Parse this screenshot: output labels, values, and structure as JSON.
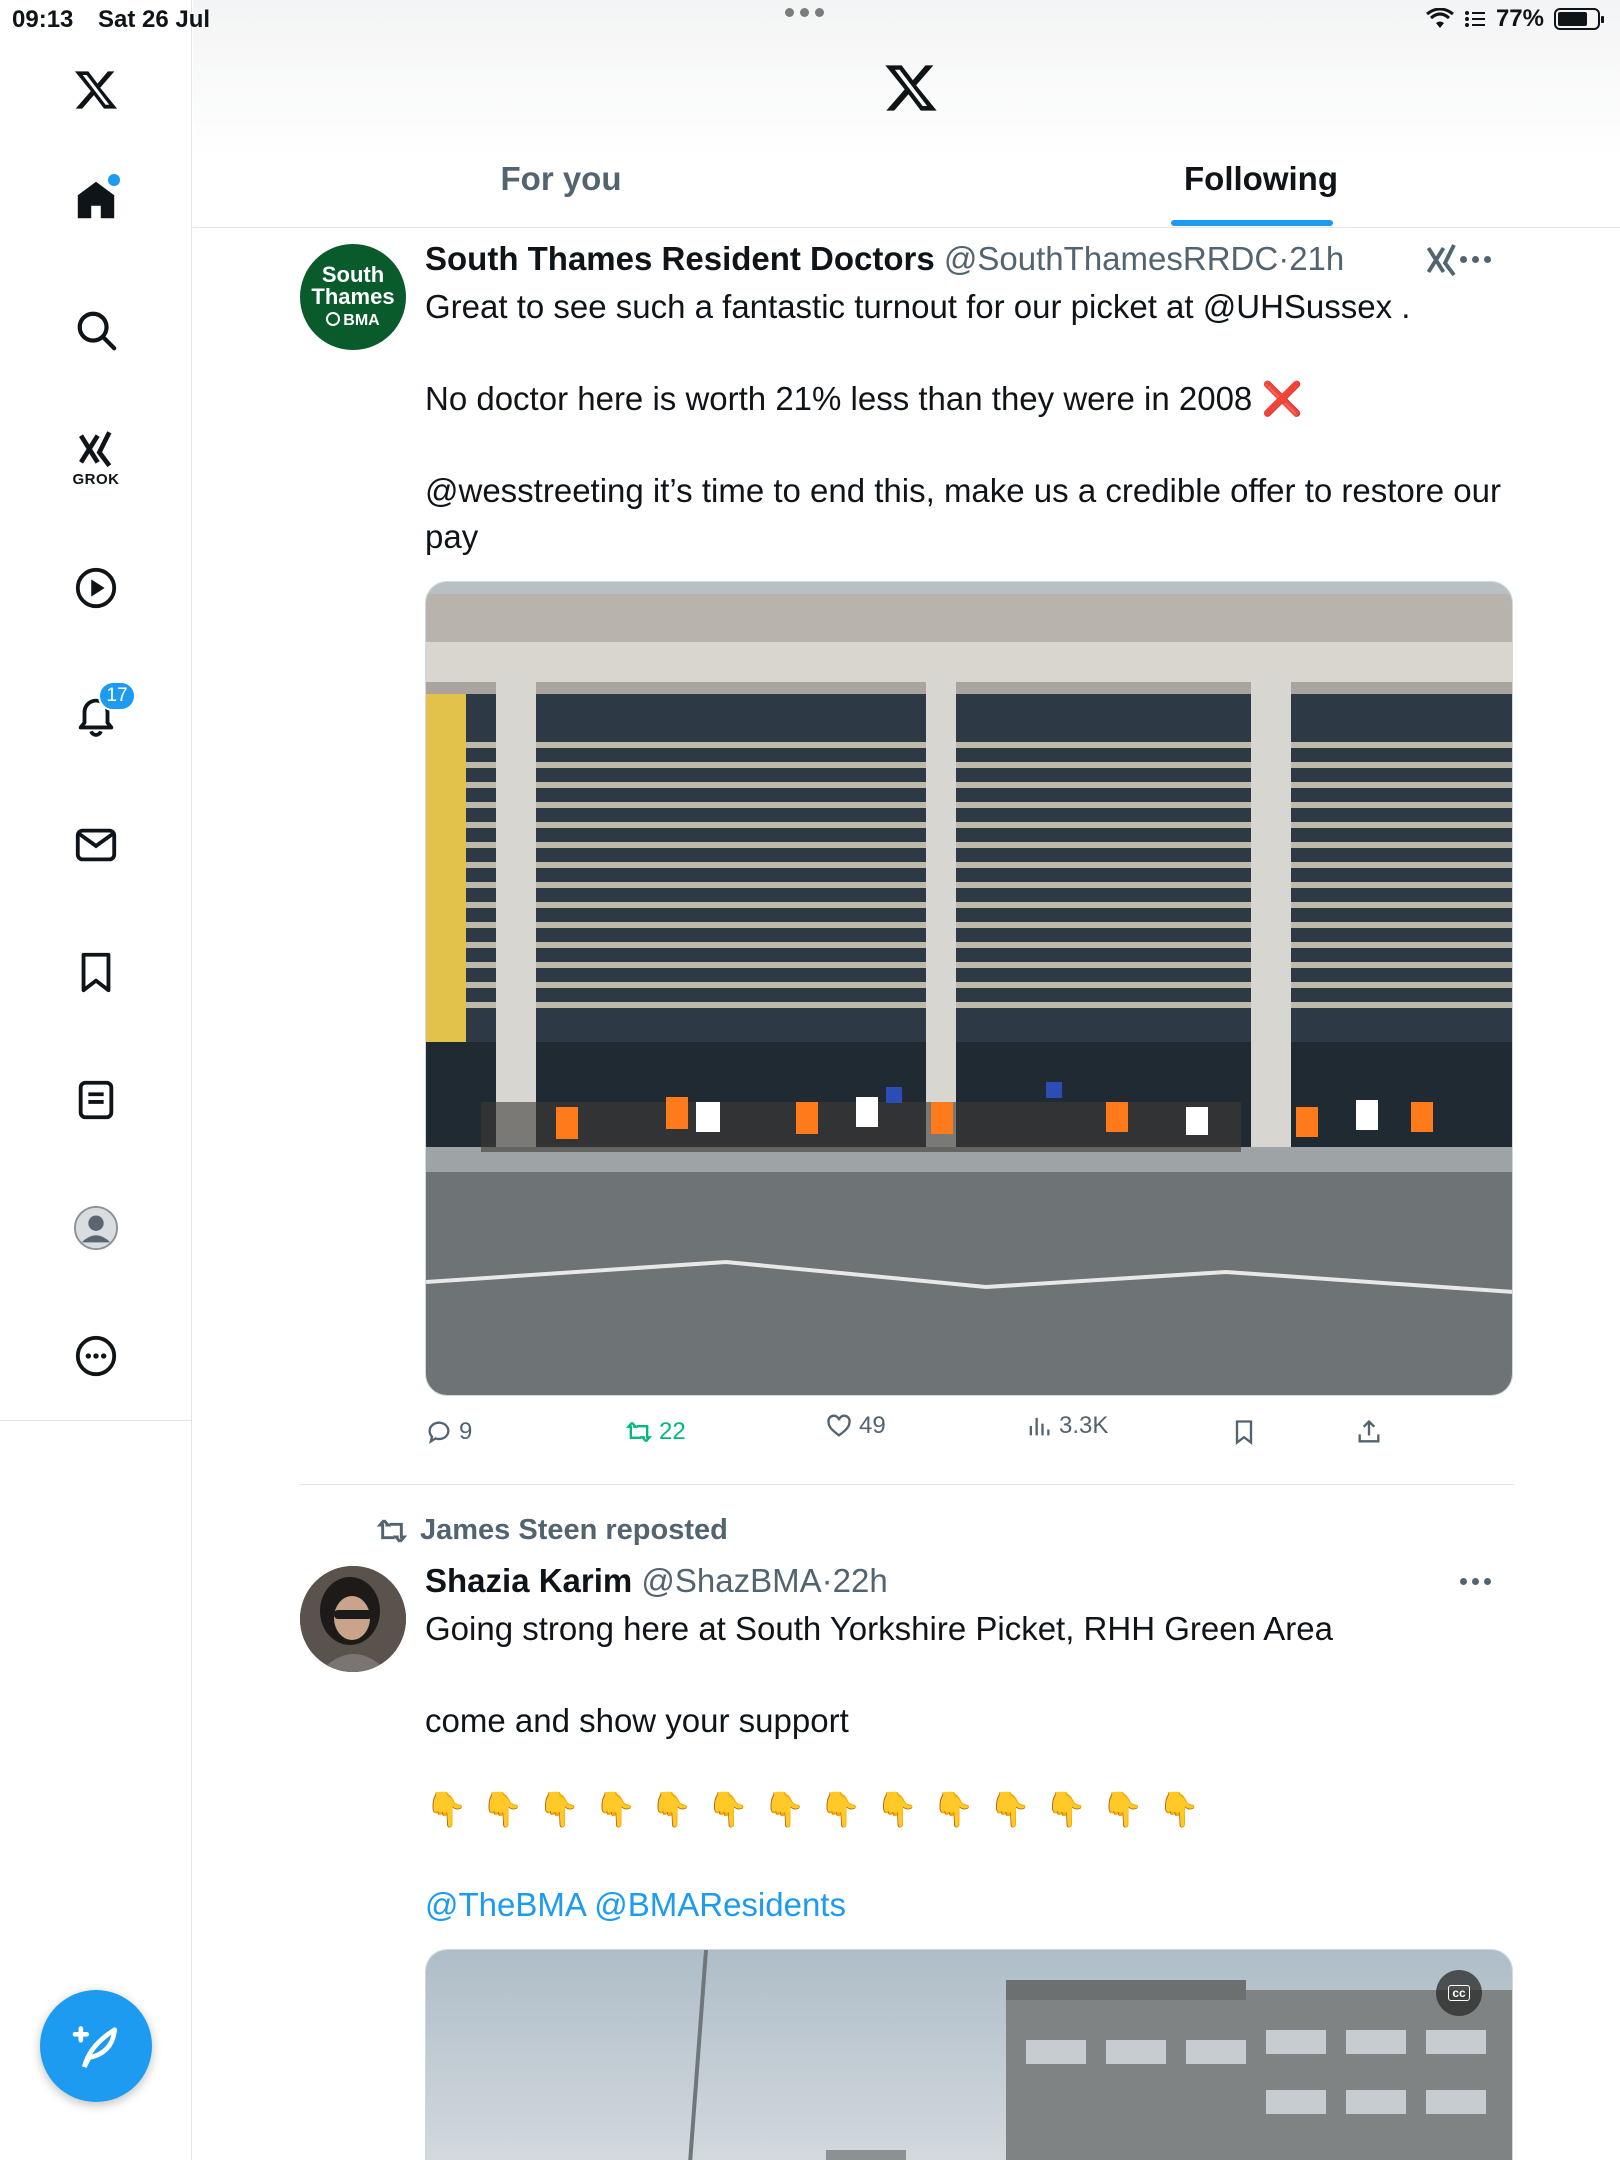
{
  "status_bar": {
    "time": "09:13",
    "date": "Sat 26 Jul",
    "battery": "77%",
    "battery_level": 0.77
  },
  "sidebar": {
    "grok_label": "GROK",
    "notifications_count": "17",
    "items": [
      "home",
      "search",
      "grok",
      "video",
      "notifications",
      "messages",
      "bookmarks",
      "lists",
      "profile",
      "more"
    ]
  },
  "header": {
    "tabs": [
      {
        "label": "For you",
        "active": false
      },
      {
        "label": "Following",
        "active": true
      }
    ]
  },
  "tweets": [
    {
      "avatar_text": [
        "South",
        "Thames",
        "BMA"
      ],
      "name": "South Thames Resident Doctors",
      "handle": "@SouthThamesRRDC",
      "sep": "·",
      "time": "21h",
      "text_line1_prefix": "Great to see such a fantastic turnout for our picket at ",
      "text_line1_link": "@UHSussex",
      "text_line1_suffix": " .",
      "text_line2": "No doctor here is worth 21% less than they were in 2008 ",
      "text_line2_emoji": "❌",
      "text_line3": "@wesstreeting it’s time to end this, make us a credible offer to restore our pay",
      "actions": {
        "replies": "9",
        "reposts": "22",
        "likes": "49",
        "views": "3.3K"
      }
    },
    {
      "reposted_by": "James Steen reposted",
      "name": "Shazia Karim",
      "handle": "@ShazBMA",
      "sep": "·",
      "time": "22h",
      "text_line1": "Going strong here at South Yorkshire Picket, RHH Green Area",
      "text_line2": "come and show your support",
      "emojis": [
        "👇",
        "👇",
        "👇",
        "👇",
        "👇",
        "👇",
        "👇",
        "👇",
        "👇",
        "👇",
        "👇",
        "👇",
        "👇",
        "👇"
      ],
      "mentions": "@TheBMA @BMAResidents",
      "video_cc": "cc"
    }
  ],
  "colors": {
    "accent": "#1d9bf0",
    "repost_green": "#00ba7c",
    "secondary_text": "#536471",
    "avatar_green": "#0a5b2c"
  }
}
